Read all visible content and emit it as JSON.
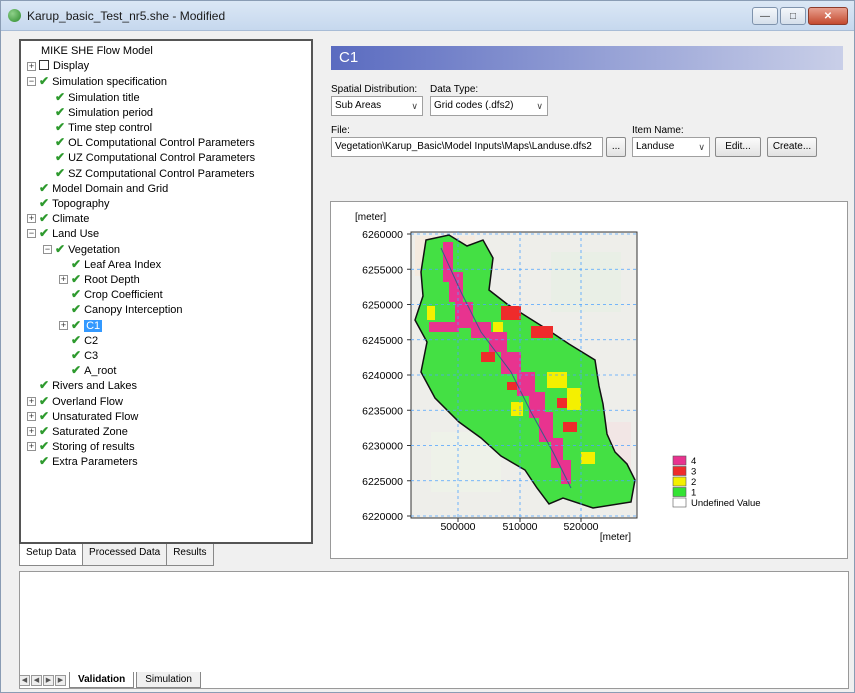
{
  "window": {
    "title": "Karup_basic_Test_nr5.she - Modified"
  },
  "tree": [
    {
      "label": "MIKE SHE Flow Model",
      "indent": 0,
      "exp": "",
      "icon": "none"
    },
    {
      "label": "Display",
      "indent": 0,
      "exp": "+",
      "icon": "box"
    },
    {
      "label": "Simulation specification",
      "indent": 0,
      "exp": "-",
      "icon": "check"
    },
    {
      "label": "Simulation title",
      "indent": 1,
      "exp": "",
      "icon": "check"
    },
    {
      "label": "Simulation period",
      "indent": 1,
      "exp": "",
      "icon": "check"
    },
    {
      "label": "Time step control",
      "indent": 1,
      "exp": "",
      "icon": "check"
    },
    {
      "label": "OL Computational Control Parameters",
      "indent": 1,
      "exp": "",
      "icon": "check"
    },
    {
      "label": "UZ Computational Control Parameters",
      "indent": 1,
      "exp": "",
      "icon": "check"
    },
    {
      "label": "SZ Computational Control Parameters",
      "indent": 1,
      "exp": "",
      "icon": "check"
    },
    {
      "label": "Model Domain and Grid",
      "indent": 0,
      "exp": "",
      "icon": "check"
    },
    {
      "label": "Topography",
      "indent": 0,
      "exp": "",
      "icon": "check"
    },
    {
      "label": "Climate",
      "indent": 0,
      "exp": "+",
      "icon": "check"
    },
    {
      "label": "Land Use",
      "indent": 0,
      "exp": "-",
      "icon": "check"
    },
    {
      "label": "Vegetation",
      "indent": 1,
      "exp": "-",
      "icon": "check"
    },
    {
      "label": "Leaf Area Index",
      "indent": 2,
      "exp": "",
      "icon": "check"
    },
    {
      "label": "Root Depth",
      "indent": 2,
      "exp": "+",
      "icon": "check"
    },
    {
      "label": "Crop Coefficient",
      "indent": 2,
      "exp": "",
      "icon": "check"
    },
    {
      "label": "Canopy Interception",
      "indent": 2,
      "exp": "",
      "icon": "check"
    },
    {
      "label": "C1",
      "indent": 2,
      "exp": "+",
      "icon": "check",
      "selected": true
    },
    {
      "label": "C2",
      "indent": 2,
      "exp": "",
      "icon": "check"
    },
    {
      "label": "C3",
      "indent": 2,
      "exp": "",
      "icon": "check"
    },
    {
      "label": "A_root",
      "indent": 2,
      "exp": "",
      "icon": "check"
    },
    {
      "label": "Rivers and Lakes",
      "indent": 0,
      "exp": "",
      "icon": "check"
    },
    {
      "label": "Overland Flow",
      "indent": 0,
      "exp": "+",
      "icon": "check"
    },
    {
      "label": "Unsaturated Flow",
      "indent": 0,
      "exp": "+",
      "icon": "check"
    },
    {
      "label": "Saturated Zone",
      "indent": 0,
      "exp": "+",
      "icon": "check"
    },
    {
      "label": "Storing of results",
      "indent": 0,
      "exp": "+",
      "icon": "check"
    },
    {
      "label": "Extra Parameters",
      "indent": 0,
      "exp": "",
      "icon": "check"
    }
  ],
  "left_tabs": [
    "Setup Data",
    "Processed Data",
    "Results"
  ],
  "panel": {
    "title": "C1",
    "spatial_label": "Spatial Distribution:",
    "spatial_value": "Sub Areas",
    "datatype_label": "Data Type:",
    "datatype_value": "Grid codes (.dfs2)",
    "file_label": "File:",
    "file_value": "Vegetation\\Karup_Basic\\Model Inputs\\Maps\\Landuse.dfs2",
    "browse": "...",
    "item_label": "Item Name:",
    "item_value": "Landuse",
    "edit": "Edit...",
    "create": "Create..."
  },
  "map": {
    "y_unit": "[meter]",
    "x_unit": "[meter]",
    "yticks": [
      "6260000",
      "6255000",
      "6250000",
      "6245000",
      "6240000",
      "6235000",
      "6230000",
      "6225000",
      "6220000"
    ],
    "xticks": [
      "500000",
      "510000",
      "520000"
    ],
    "legend": [
      {
        "label": "4",
        "color": "#e8338f"
      },
      {
        "label": "3",
        "color": "#ef2b2b"
      },
      {
        "label": "2",
        "color": "#f4f000"
      },
      {
        "label": "1",
        "color": "#33e333"
      },
      {
        "label": "Undefined Value",
        "color": "#ffffff"
      }
    ]
  },
  "bottom_tabs": [
    "Validation",
    "Simulation"
  ]
}
